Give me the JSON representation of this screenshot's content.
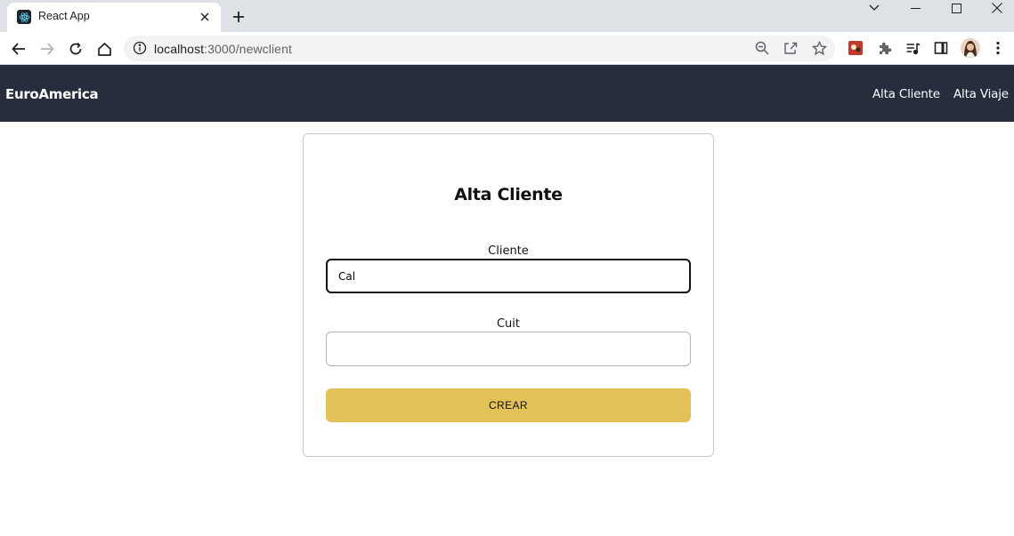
{
  "browser": {
    "tab_title": "React App",
    "url_host": "localhost",
    "url_path": ":3000/newclient",
    "icons": [
      "react-favicon",
      "close-icon",
      "plus-icon",
      "chevron-down-icon",
      "minimize-icon",
      "maximize-icon",
      "window-close-icon",
      "back-icon",
      "forward-icon",
      "reload-icon",
      "home-icon",
      "info-icon",
      "zoom-out-icon",
      "share-icon",
      "star-icon",
      "extension-icon",
      "puzzle-icon",
      "media-icon",
      "side-panel-icon",
      "profile-avatar",
      "kebab-menu-icon"
    ]
  },
  "navbar": {
    "brand": "EuroAmerica",
    "links": [
      "Alta Cliente",
      "Alta Viaje"
    ],
    "bg_color": "#262e3d"
  },
  "form": {
    "title": "Alta Cliente",
    "cliente_label": "Cliente",
    "cliente_value": "Cal",
    "cuit_label": "Cuit",
    "cuit_value": "",
    "submit_label": "CREAR",
    "button_color": "#e2c158"
  }
}
